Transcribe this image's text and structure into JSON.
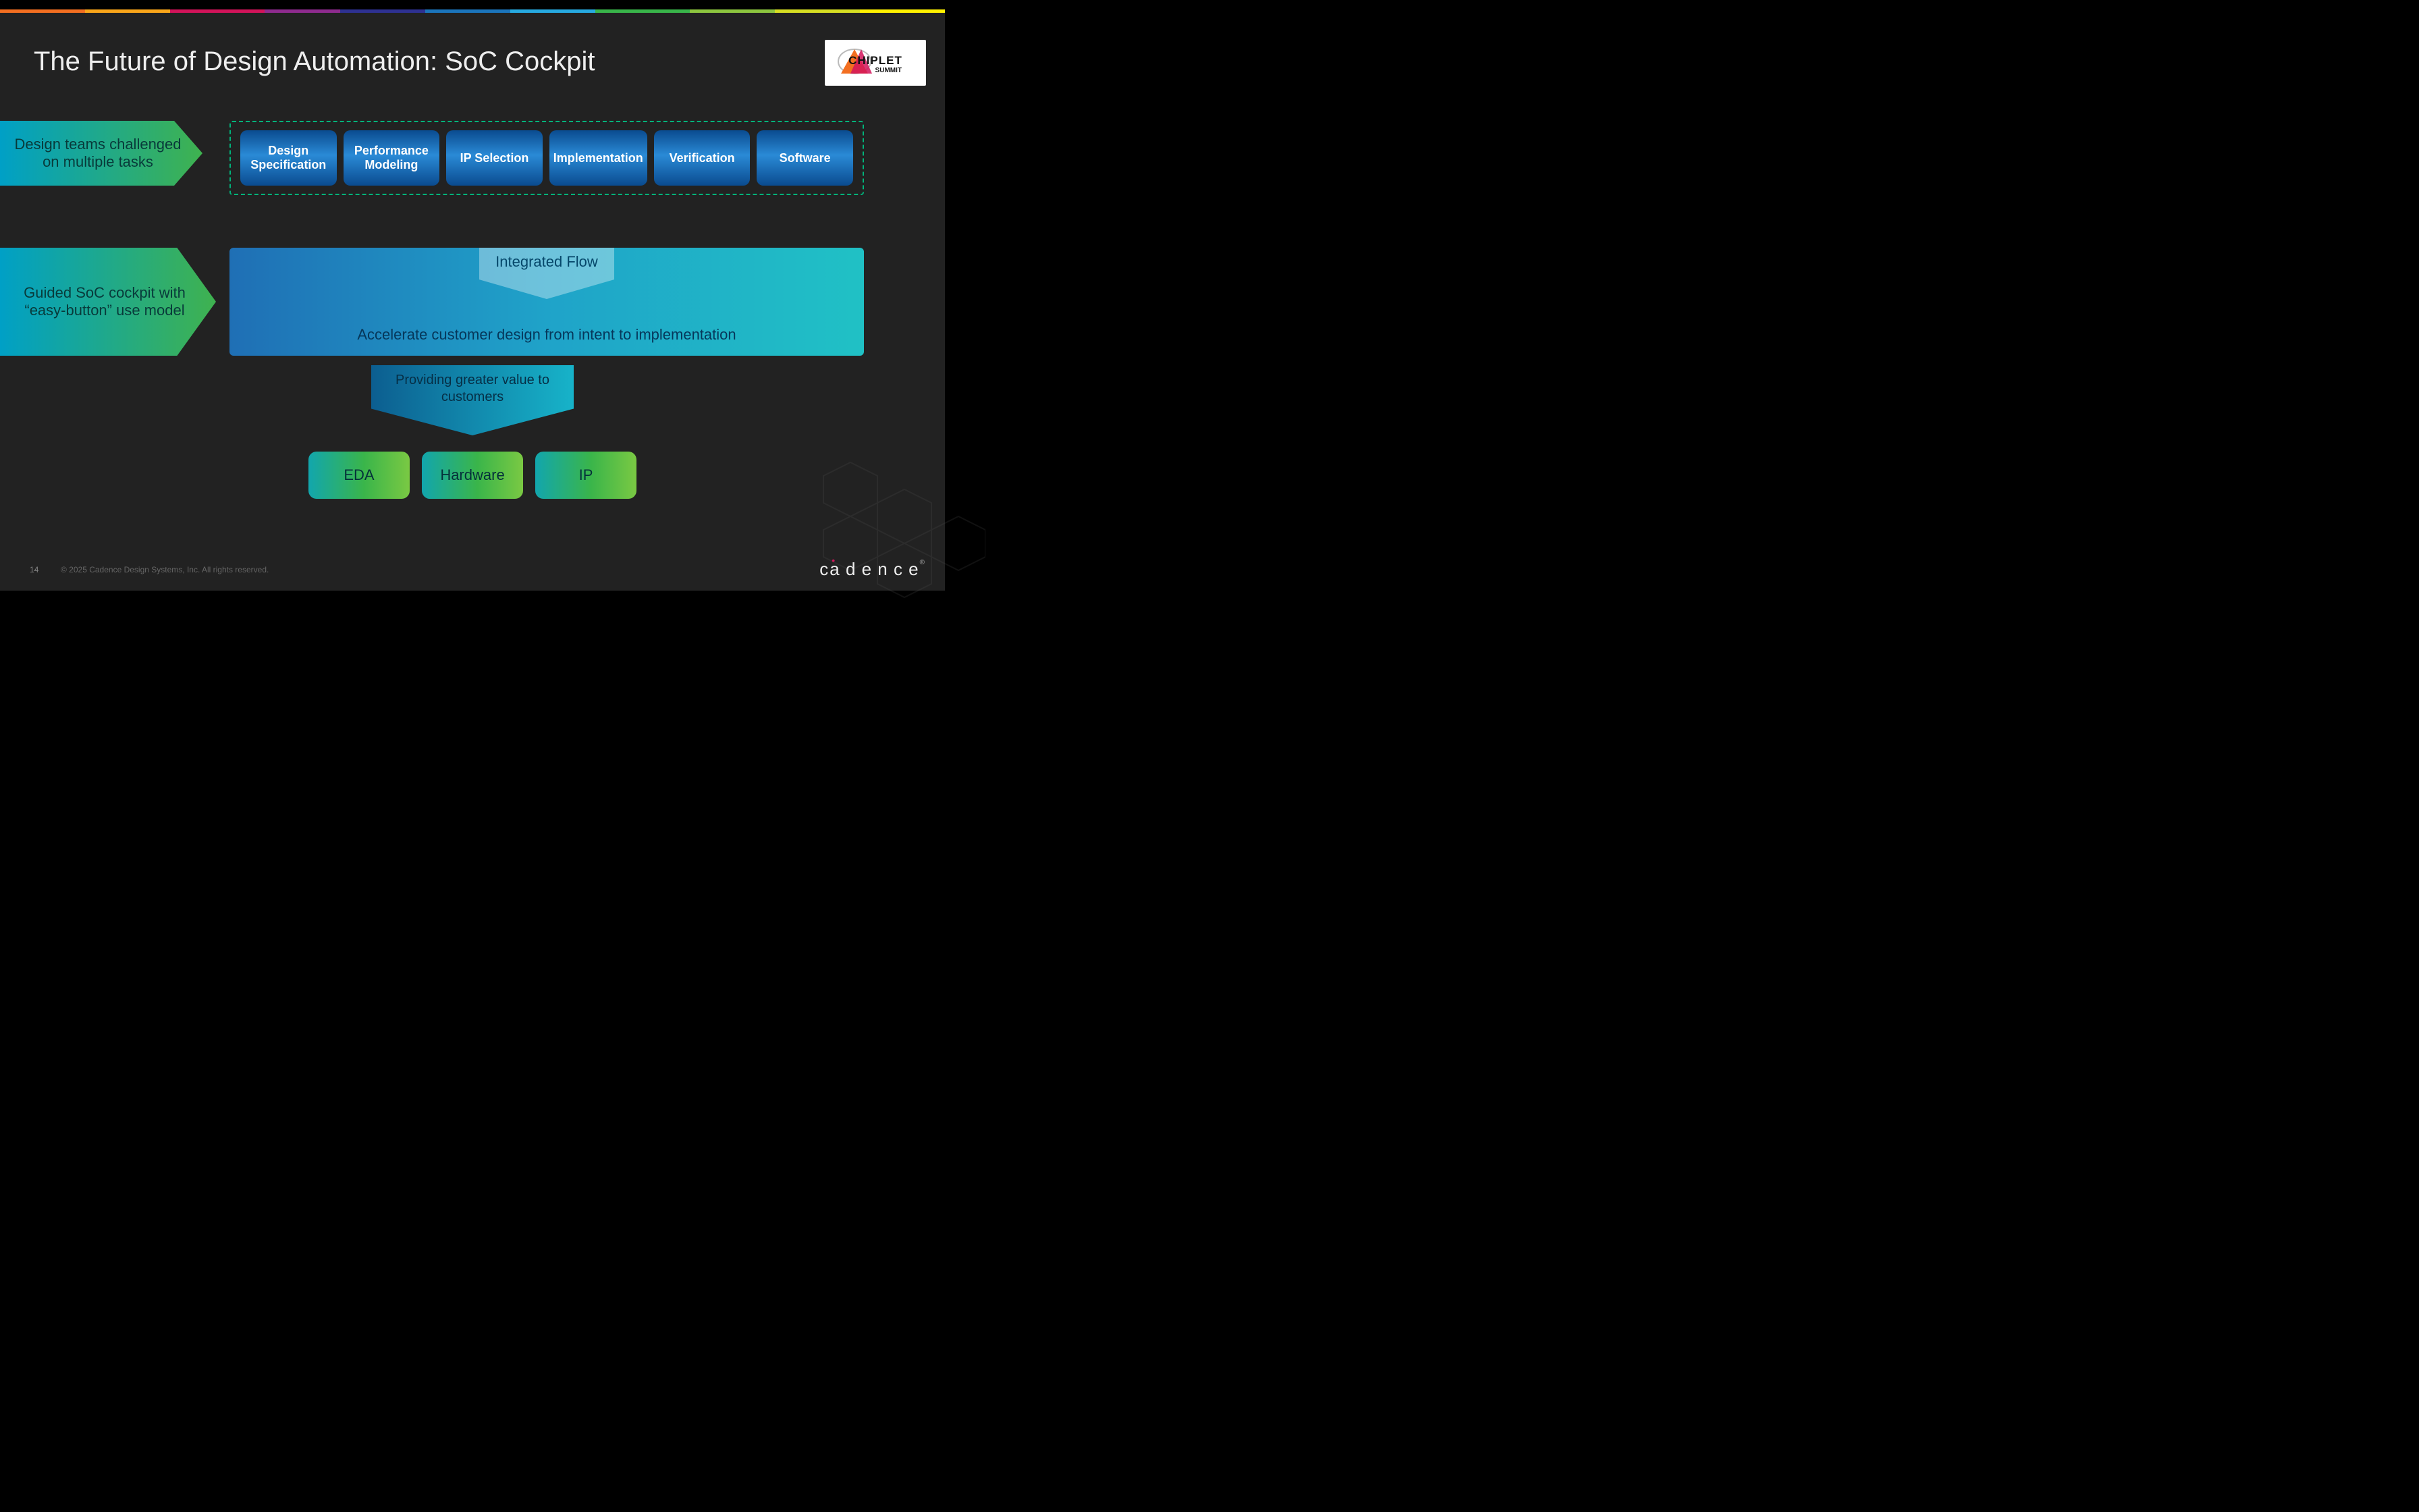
{
  "title": "The Future of Design Automation: SoC Cockpit",
  "logo_chiplet": {
    "line1": "CHIPLET",
    "line2": "SUMMIT"
  },
  "callouts": {
    "top": "Design teams challenged on multiple tasks",
    "mid": "Guided SoC cockpit with “easy-button” use model"
  },
  "tasks": [
    "Design Specification",
    "Performance Modeling",
    "IP Selection",
    "Implementation",
    "Verification",
    "Software"
  ],
  "panel": {
    "tab": "Integrated Flow",
    "text": "Accelerate customer design from intent to implementation"
  },
  "value_arrow": "Providing greater value to customers",
  "pills": [
    "EDA",
    "Hardware",
    "IP"
  ],
  "footer": {
    "page": "14",
    "copyright": "© 2025 Cadence Design Systems, Inc. All rights reserved.",
    "brand": "cādence"
  }
}
